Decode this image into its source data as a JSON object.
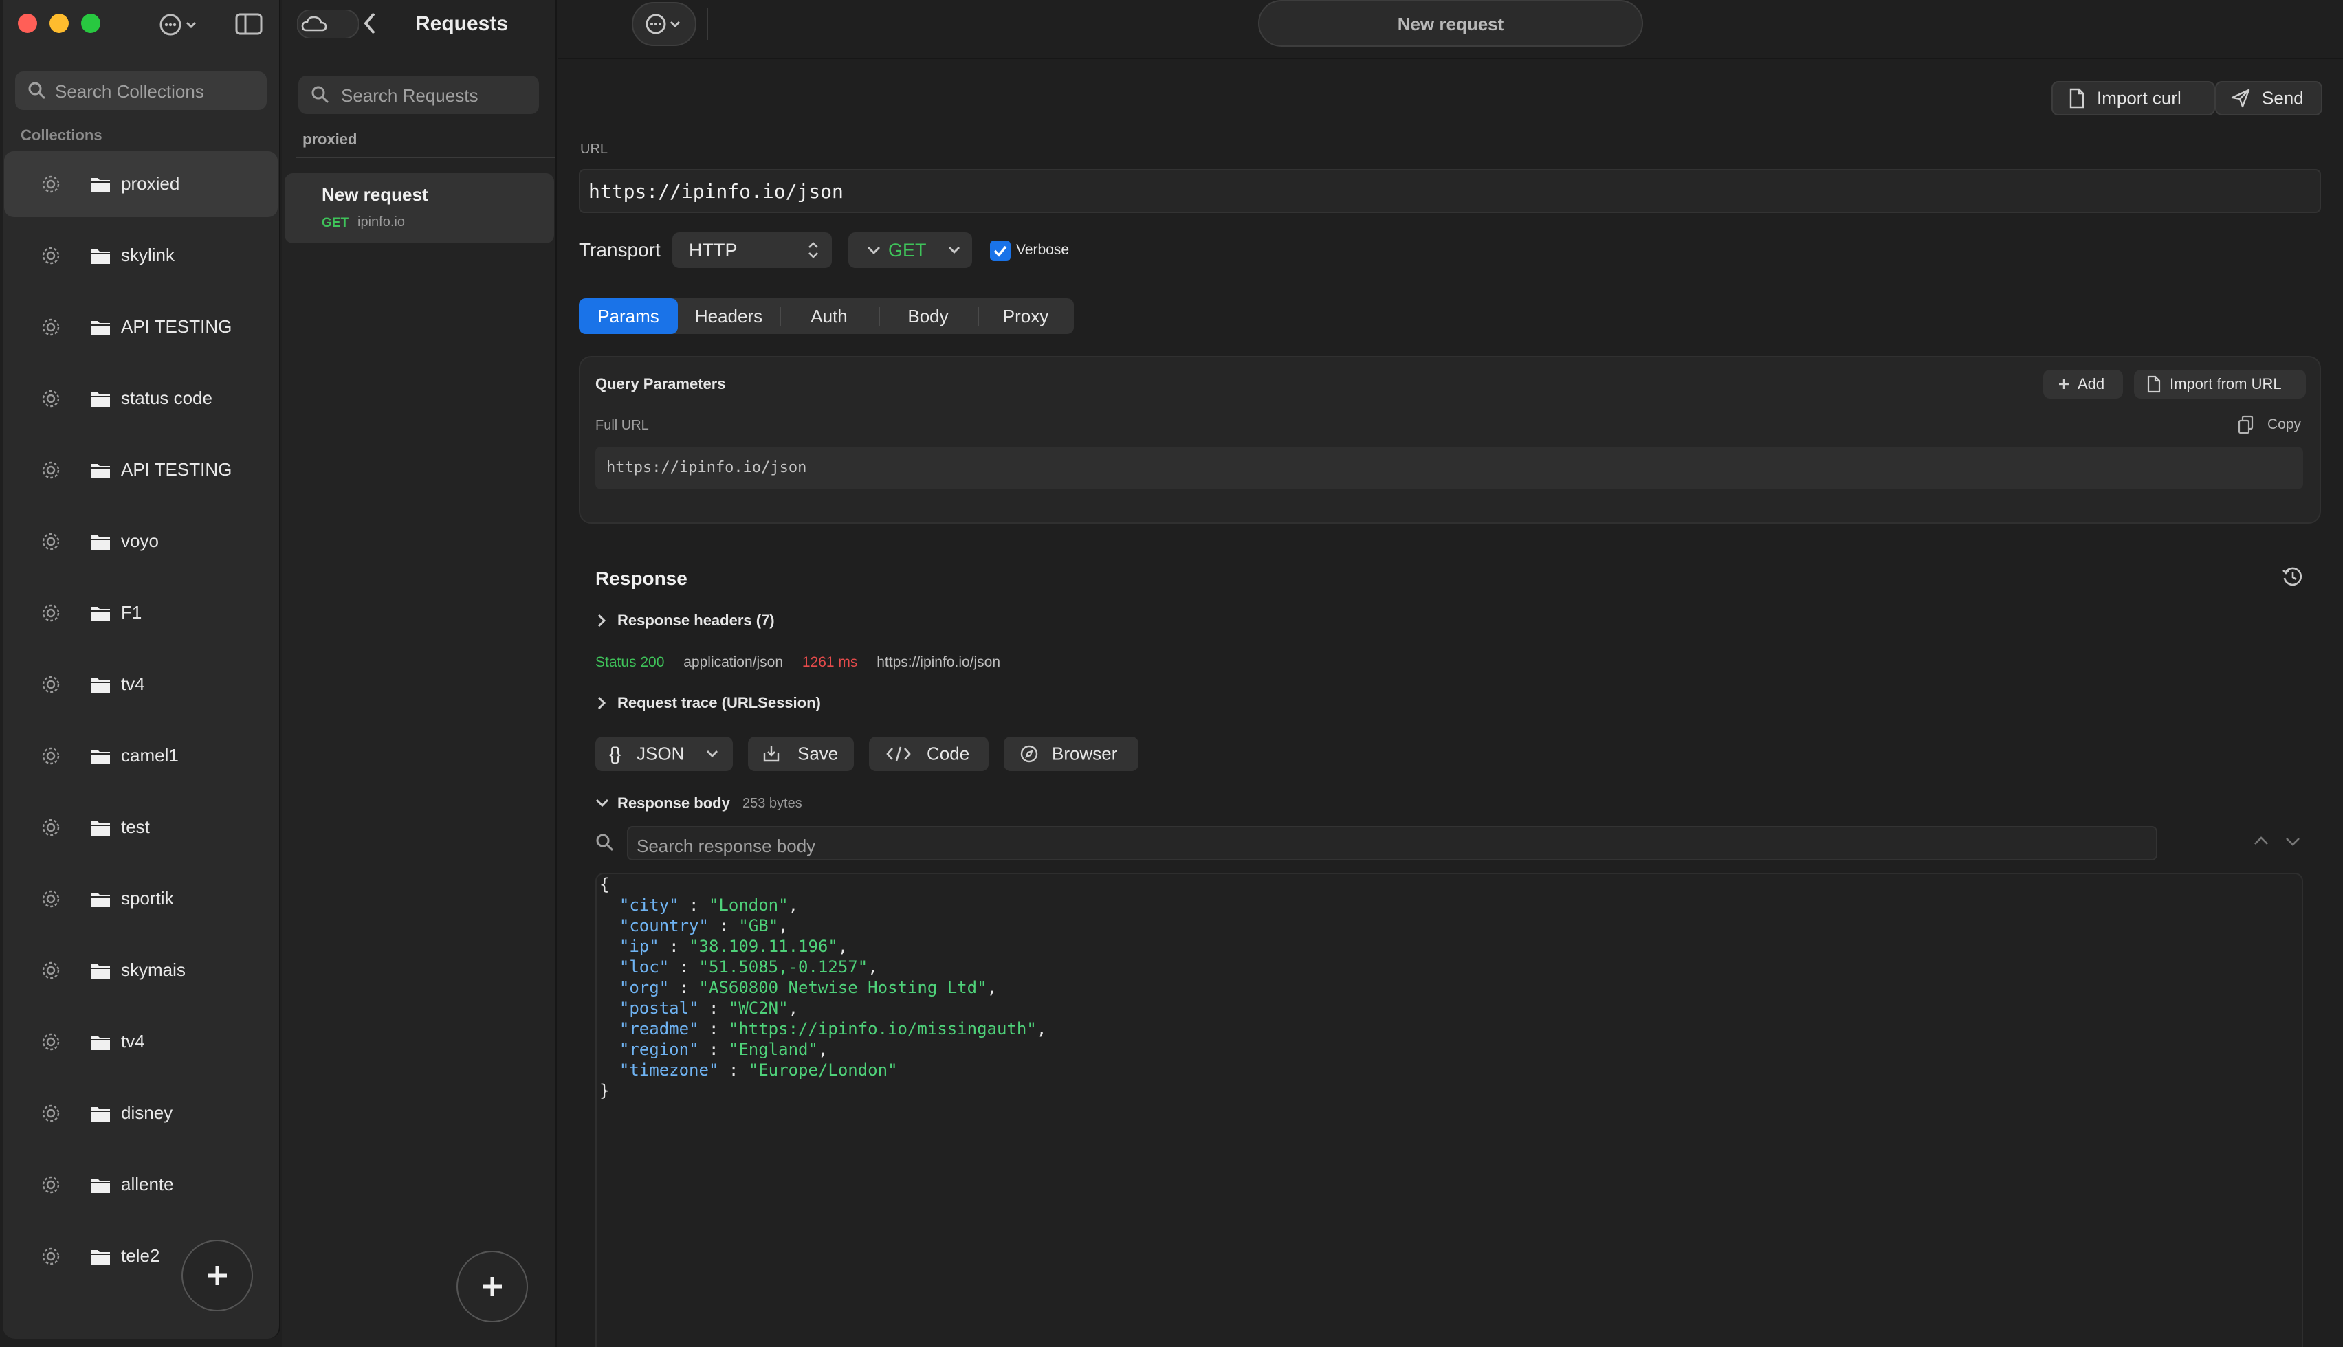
{
  "window": {
    "title": "New request"
  },
  "colors": {
    "accent": "#1a73e8",
    "success": "#3fc35a",
    "error": "#e54b4b",
    "json_key": "#6fb3f2",
    "json_string": "#4fd27a"
  },
  "collections": {
    "search_placeholder": "Search Collections",
    "section_label": "Collections",
    "items": [
      {
        "label": "proxied"
      },
      {
        "label": "skylink"
      },
      {
        "label": "API TESTING"
      },
      {
        "label": "status code"
      },
      {
        "label": "API TESTING"
      },
      {
        "label": "voyo"
      },
      {
        "label": "F1"
      },
      {
        "label": "tv4"
      },
      {
        "label": "camel1"
      },
      {
        "label": "test"
      },
      {
        "label": "sportik"
      },
      {
        "label": "skymais"
      },
      {
        "label": "tv4"
      },
      {
        "label": "disney"
      },
      {
        "label": "allente"
      },
      {
        "label": "tele2"
      }
    ]
  },
  "requests": {
    "title": "Requests",
    "search_placeholder": "Search Requests",
    "group": "proxied",
    "items": [
      {
        "name": "New request",
        "method": "GET",
        "host": "ipinfo.io"
      }
    ]
  },
  "toolbar": {
    "import_curl": "Import curl",
    "send": "Send"
  },
  "request": {
    "url_label": "URL",
    "url": "https://ipinfo.io/json",
    "transport_label": "Transport",
    "transport": "HTTP",
    "method": "GET",
    "verbose_label": "Verbose",
    "verbose_checked": true,
    "tabs": [
      "Params",
      "Headers",
      "Auth",
      "Body",
      "Proxy"
    ],
    "active_tab": "Params"
  },
  "params": {
    "title": "Query Parameters",
    "add_label": "Add",
    "import_label": "Import from URL",
    "full_url_label": "Full URL",
    "copy_label": "Copy",
    "full_url": "https://ipinfo.io/json"
  },
  "response": {
    "title": "Response",
    "headers_label": "Response headers (7)",
    "status": "Status 200",
    "content_type": "application/json",
    "time": "1261 ms",
    "url": "https://ipinfo.io/json",
    "trace_label": "Request trace (URLSession)",
    "format": "JSON",
    "save_label": "Save",
    "code_label": "Code",
    "browser_label": "Browser",
    "body_label": "Response body",
    "body_size": "253 bytes",
    "search_placeholder": "Search response body",
    "body": [
      {
        "key": "city",
        "value": "London"
      },
      {
        "key": "country",
        "value": "GB"
      },
      {
        "key": "ip",
        "value": "38.109.11.196"
      },
      {
        "key": "loc",
        "value": "51.5085,-0.1257"
      },
      {
        "key": "org",
        "value": "AS60800 Netwise Hosting Ltd"
      },
      {
        "key": "postal",
        "value": "WC2N"
      },
      {
        "key": "readme",
        "value": "https://ipinfo.io/missingauth"
      },
      {
        "key": "region",
        "value": "England"
      },
      {
        "key": "timezone",
        "value": "Europe/London"
      }
    ]
  }
}
